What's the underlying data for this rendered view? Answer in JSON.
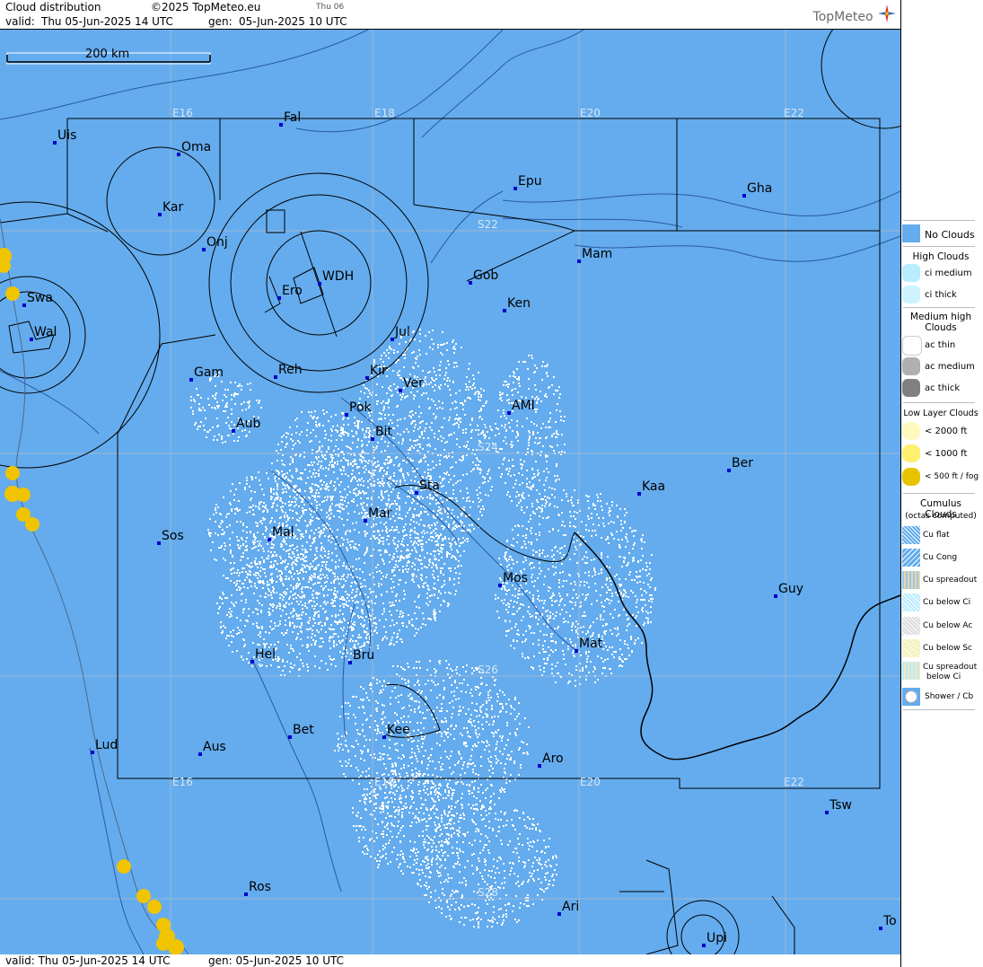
{
  "header": {
    "title": "Cloud distribution",
    "copyright": "©2025 TopMeteo.eu",
    "day_tag": "Thu 06",
    "valid_label": "valid:",
    "valid_value": "Thu  05-Jun-2025  14 UTC",
    "gen_label": "gen:",
    "gen_value": "05-Jun-2025 10 UTC",
    "brand": "TopMeteo"
  },
  "footer": {
    "valid": "valid:  Thu  05-Jun-2025  14 UTC",
    "gen": "gen: 05-Jun-2025 10 UTC"
  },
  "scale": {
    "label": "200 km"
  },
  "grid_labels": {
    "lon_top": [
      "E16",
      "E18",
      "E20",
      "E22"
    ],
    "lon_bottom": [
      "E16",
      "E18",
      "E20",
      "E22"
    ],
    "lat": [
      "S22",
      "S24",
      "S26",
      "S28"
    ]
  },
  "cities": [
    "Uis",
    "Fal",
    "Oma",
    "Kar",
    "Onj",
    "Epu",
    "Gha",
    "Swa",
    "Wal",
    "Ero",
    "WDH",
    "Gob",
    "Mam",
    "Ken",
    "Jul",
    "Gam",
    "Reh",
    "Kir",
    "Ver",
    "Pok",
    "AMI",
    "Aub",
    "Bit",
    "Sta",
    "Ber",
    "Kaa",
    "Mar",
    "Sos",
    "Mal",
    "Mos",
    "Guy",
    "Mat",
    "Hel",
    "Bru",
    "Bet",
    "Kee",
    "Lud",
    "Aus",
    "Aro",
    "Tsw",
    "Ros",
    "Ari",
    "Upi",
    "To"
  ],
  "legend": {
    "no_clouds": "No Clouds",
    "high_head": "High Clouds",
    "ci_medium": "ci medium",
    "ci_thick": "ci thick",
    "mid_head": "Medium high Clouds",
    "ac_thin": "ac thin",
    "ac_medium": "ac medium",
    "ac_thick": "ac thick",
    "low_head": "Low Layer Clouds",
    "low_2000": "< 2000 ft",
    "low_1000": "< 1000 ft",
    "low_500": "< 500 ft / fog",
    "cu_head": "Cumulus Clouds",
    "cu_sub": "(octas computed)",
    "cu_flat": "Cu flat",
    "cu_cong": "Cu Cong",
    "cu_spreadout": "Cu spreadout",
    "cu_below_ci": "Cu below Ci",
    "cu_below_ac": "Cu below Ac",
    "cu_below_sc": "Cu below Sc",
    "cu_spread_ci_1": "Cu spreadout",
    "cu_spread_ci_2": "below Ci",
    "shower": "Shower / Cb"
  },
  "colors": {
    "no_clouds": "#64acee",
    "ci_medium": "#b8ecff",
    "ci_thick": "#cdf3ff",
    "ac_medium": "#b0b0b0",
    "ac_thick": "#808080",
    "low_2000": "#fff9c0",
    "low_1000": "#fff070",
    "low_500": "#e8c400",
    "city_dot": "#0000cc"
  }
}
